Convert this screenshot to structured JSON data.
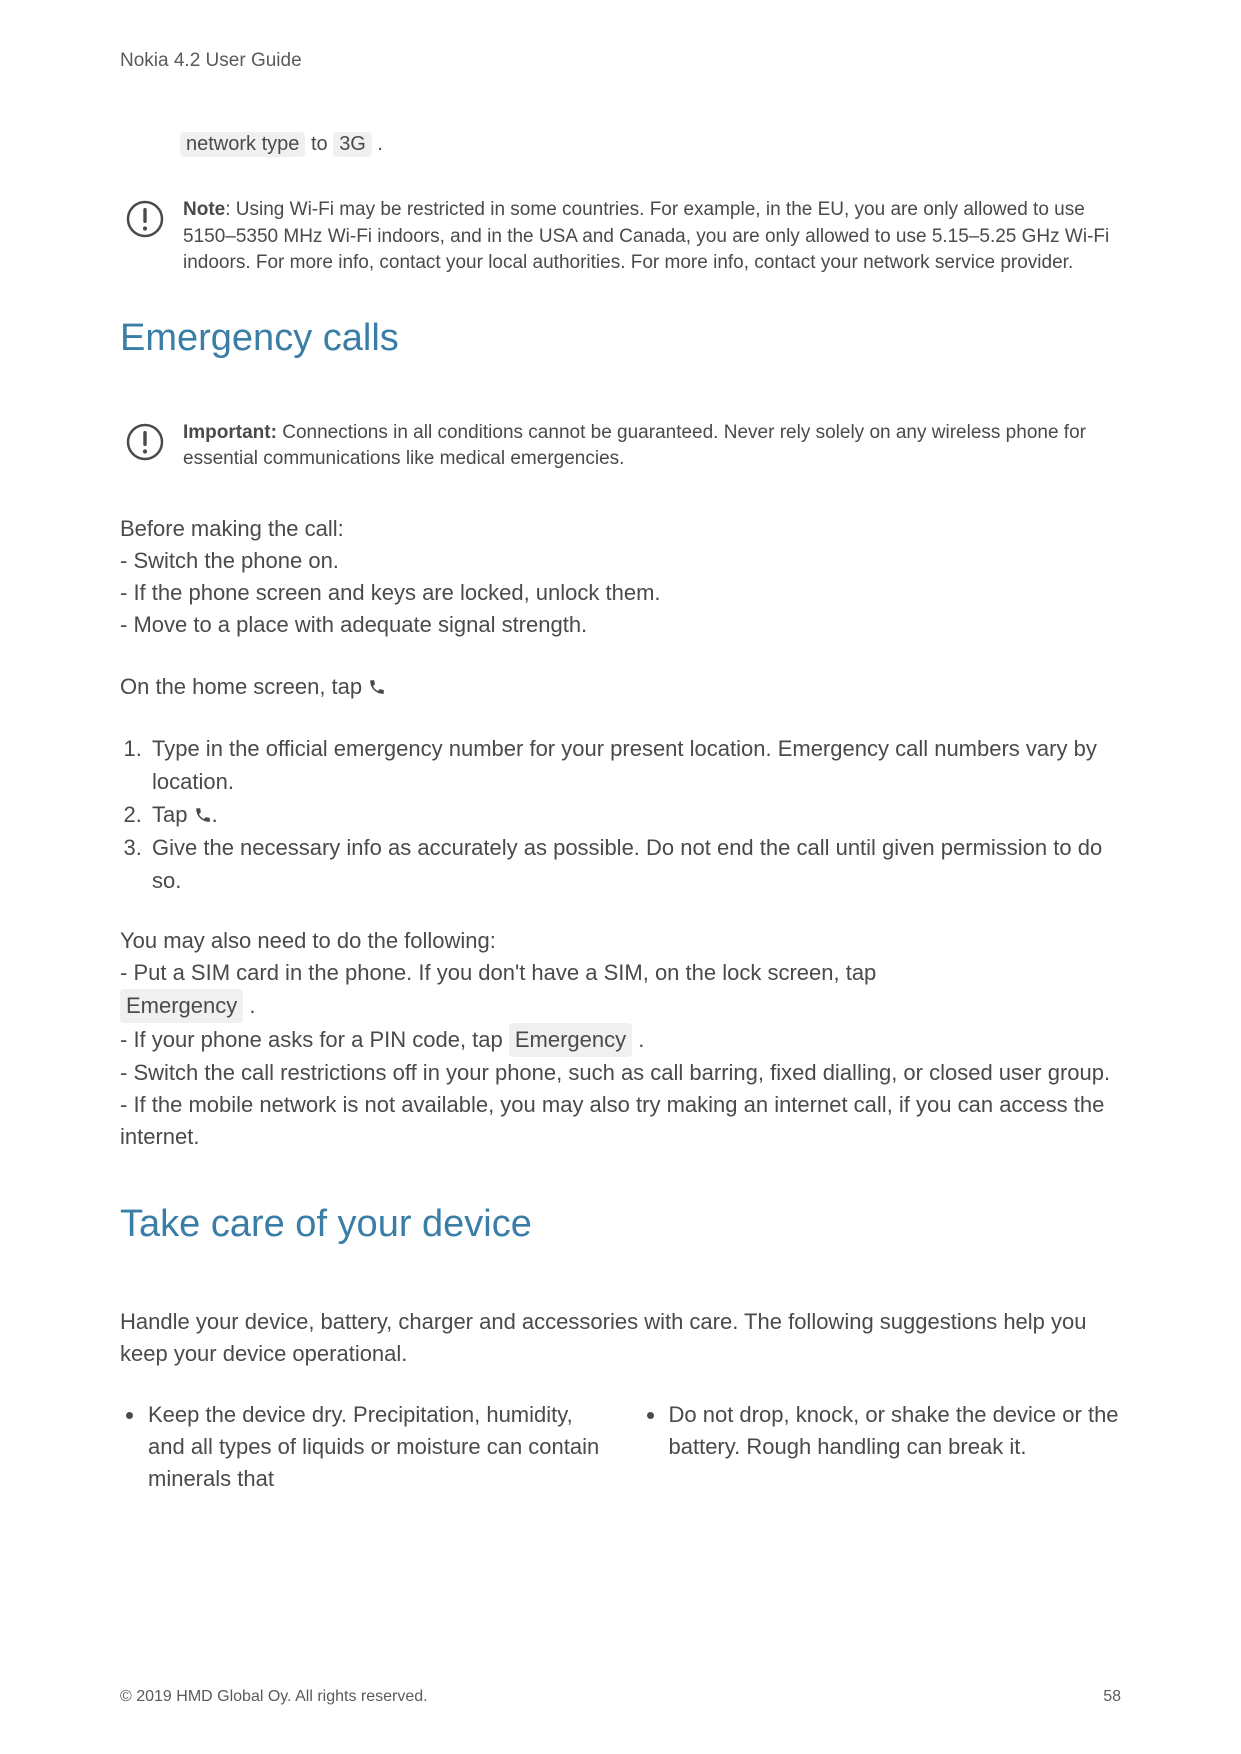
{
  "header": {
    "title": "Nokia 4.2 User Guide"
  },
  "continuation": {
    "prefix": "network type",
    "mid": " to ",
    "chip": "3G",
    "suffix": " ."
  },
  "note1": {
    "label": "Note",
    "text": ": Using Wi-Fi may be restricted in some countries. For example, in the EU, you are only allowed to use 5150–5350 MHz Wi-Fi indoors, and in the USA and Canada, you are only allowed to use 5.15–5.25 GHz Wi-Fi indoors. For more info, contact your local authorities. For more info, contact your network service provider."
  },
  "section1": {
    "title": "Emergency calls",
    "important_label": "Important:",
    "important_text": " Connections in all conditions cannot be guaranteed. Never rely solely on any wireless phone for essential communications like medical emergencies.",
    "before_intro": "Before making the call:",
    "before_item1": "- Switch the phone on.",
    "before_item2": "- If the phone screen and keys are locked, unlock them.",
    "before_item3": "- Move to a place with adequate signal strength.",
    "home_screen": "On the home screen, tap ",
    "step1": "Type in the official emergency number for your present location. Emergency call numbers vary by location.",
    "step2_pre": "Tap ",
    "step2_post": ".",
    "step3": "Give the necessary info as accurately as possible. Do not end the call until given permission to do so.",
    "also_intro": "You may also need to do the following:",
    "also1_pre": "- Put a SIM card in the phone. If you don't have a SIM, on the lock screen, tap ",
    "also1_chip": "Emergency",
    "also1_post": " .",
    "also2_pre": "- If your phone asks for a PIN code, tap ",
    "also2_chip": "Emergency",
    "also2_post": " .",
    "also3": "- Switch the call restrictions off in your phone, such as call barring, fixed dialling, or closed user group.",
    "also4": "- If the mobile network is not available, you may also try making an internet call, if you can access the internet."
  },
  "section2": {
    "title": "Take care of your device",
    "intro": "Handle your device, battery, charger and accessories with care. The following suggestions help you keep your device operational.",
    "bullet_left": "Keep the device dry. Precipitation, humidity, and all types of liquids or moisture can contain minerals that",
    "bullet_right": "Do not drop, knock, or shake the device or the battery. Rough handling can break it."
  },
  "footer": {
    "copyright": "© 2019 HMD Global Oy. All rights reserved.",
    "page": "58"
  }
}
